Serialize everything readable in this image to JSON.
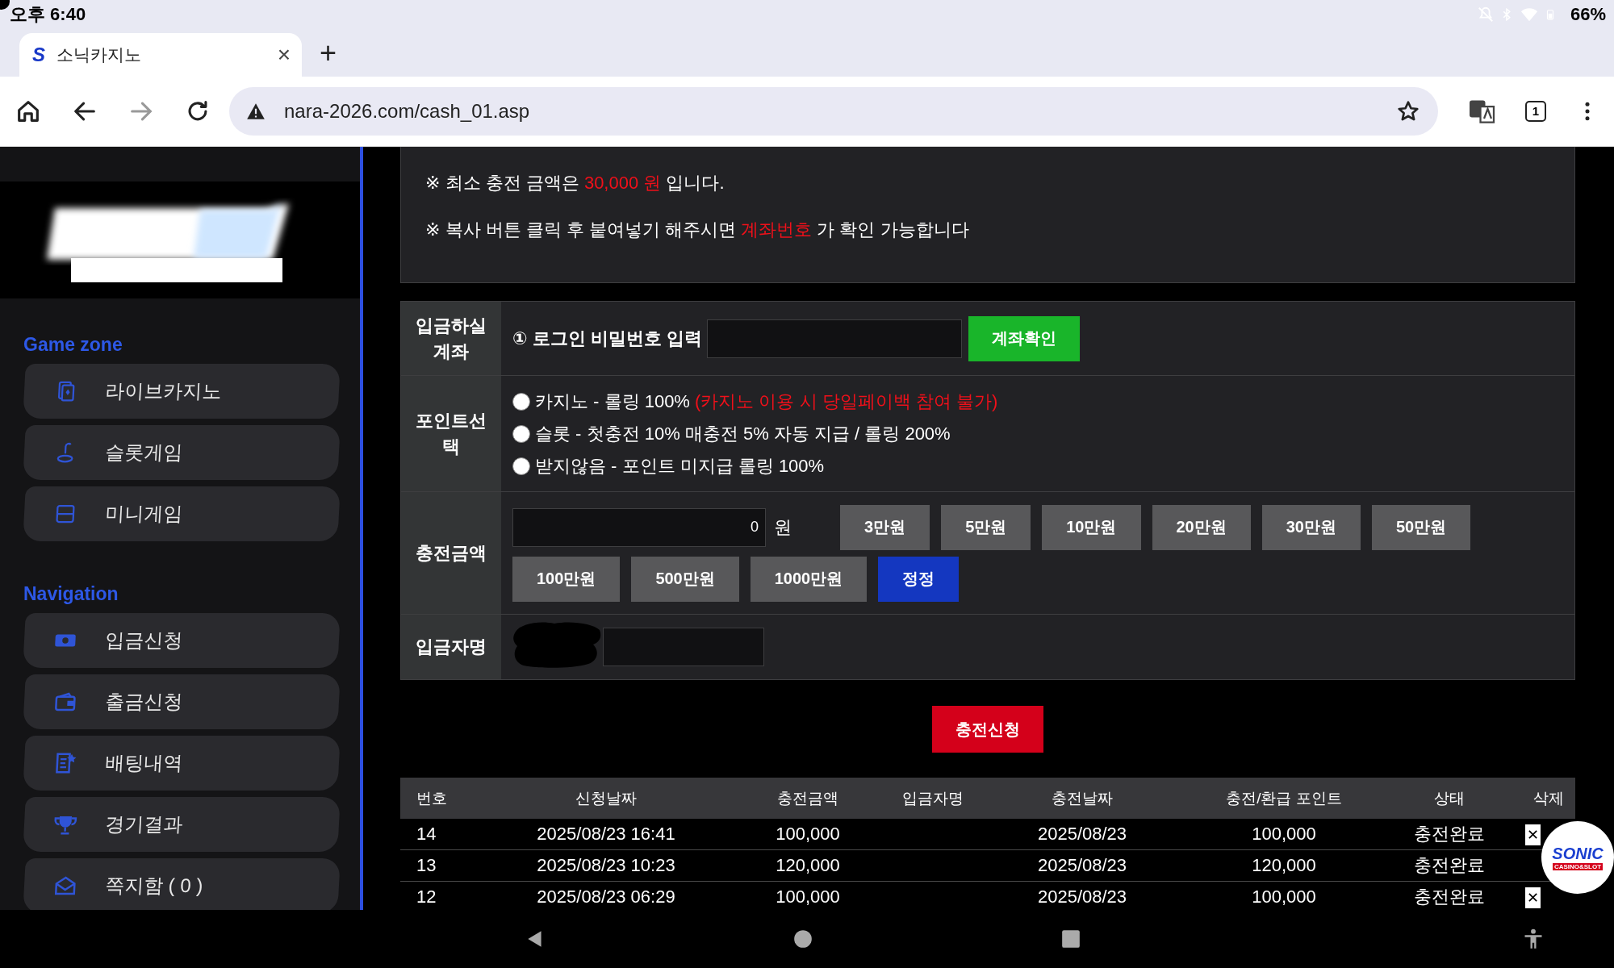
{
  "status_bar": {
    "time": "오후 6:40",
    "battery": "66%"
  },
  "browser": {
    "tab": {
      "favicon": "S",
      "title": "소닉카지노",
      "close": "×",
      "selected": true
    },
    "new_tab": "+",
    "url": "nara-2026.com/cash_01.asp",
    "tab_count": "1",
    "forward_disabled": true
  },
  "sidebar": {
    "sections": [
      {
        "title": "Game zone",
        "items": [
          {
            "label": "라이브카지노"
          },
          {
            "label": "슬롯게임"
          },
          {
            "label": "미니게임"
          }
        ]
      },
      {
        "title": "Navigation",
        "items": [
          {
            "label": "입금신청"
          },
          {
            "label": "출금신청"
          },
          {
            "label": "배팅내역"
          },
          {
            "label": "경기결과"
          },
          {
            "label": "쪽지함 ( 0 )"
          }
        ]
      }
    ]
  },
  "notices": [
    [
      {
        "text": "※ 최소 충전 금액은 "
      },
      {
        "text": "30,000 원",
        "highlight": true
      },
      {
        "text": " 입니다."
      }
    ],
    [
      {
        "text": "※ 복사 버튼 클릭 후 붙여넣기 해주시면 "
      },
      {
        "text": "계좌번호",
        "highlight": true
      },
      {
        "text": " 가 확인 가능합니다"
      }
    ]
  ],
  "form": {
    "account": {
      "label": "입금하실 계좌",
      "prompt": "① 로그인 비밀번호 입력",
      "button": "계좌확인"
    },
    "points": {
      "label": "포인트선택",
      "options": [
        {
          "text": "카지노 - 롤링 100% ",
          "note": "(카지노 이용 시 당일페이백 참여 불가)",
          "selected": false
        },
        {
          "text": "슬롯 - 첫충전 10% 매충전 5% 자동 지급 / 롤링 200%",
          "selected": false
        },
        {
          "text": "받지않음 - 포인트 미지급 롤링 100%",
          "selected": false
        }
      ]
    },
    "amount": {
      "label": "충전금액",
      "value": "0",
      "unit": "원",
      "buttons": [
        {
          "label": "3만원",
          "kind": "amount"
        },
        {
          "label": "5만원",
          "kind": "amount"
        },
        {
          "label": "10만원",
          "kind": "amount"
        },
        {
          "label": "20만원",
          "kind": "amount"
        },
        {
          "label": "30만원",
          "kind": "amount"
        },
        {
          "label": "50만원",
          "kind": "amount"
        },
        {
          "label": "100만원",
          "kind": "amount"
        },
        {
          "label": "500만원",
          "kind": "amount"
        },
        {
          "label": "1000만원",
          "kind": "amount"
        },
        {
          "label": "정정",
          "kind": "reset"
        }
      ]
    },
    "depositor": {
      "label": "입금자명",
      "redacted": true
    }
  },
  "submit": "충전신청",
  "table": {
    "columns": [
      "번호",
      "신청날짜",
      "충전금액",
      "입금자명",
      "충전날짜",
      "충전/환급 포인트",
      "상태",
      "삭제"
    ],
    "rows": [
      {
        "no": "14",
        "requested": "2025/08/23 16:41",
        "amount": "100,000",
        "charged": "2025/08/23",
        "points": "100,000",
        "status": "충전완료",
        "delete": "✕"
      },
      {
        "no": "13",
        "requested": "2025/08/23 10:23",
        "amount": "120,000",
        "charged": "2025/08/23",
        "points": "120,000",
        "status": "충전완료"
      },
      {
        "no": "12",
        "requested": "2025/08/23 06:29",
        "amount": "100,000",
        "charged": "2025/08/23",
        "points": "100,000",
        "status": "충전완료",
        "delete": "✕"
      }
    ]
  },
  "floating_badge": {
    "title": "SONIC",
    "subtitle": "CASINO&SLOT"
  }
}
